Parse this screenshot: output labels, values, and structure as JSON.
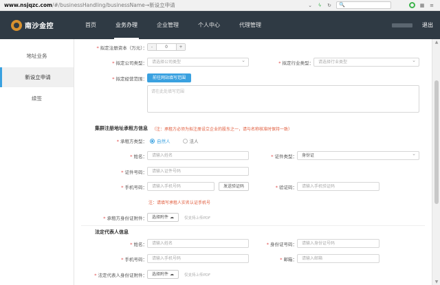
{
  "browser": {
    "url_host": "www.nsjqzc.com",
    "url_path": "/#/businessHandling/businessName→新设立申请",
    "search_placeholder": "🔍"
  },
  "topnav": {
    "logo_text": "南沙金控",
    "items": [
      "首页",
      "业务办理",
      "企业管理",
      "个人中心",
      "代理管理"
    ],
    "logout": "退出"
  },
  "sidebar": {
    "items": [
      "地址业务",
      "新设立申请",
      "续签"
    ]
  },
  "form": {
    "capital": {
      "label": "拟定注册资本（万元）：",
      "minus": "-",
      "value": "0",
      "plus": "+"
    },
    "company_type": {
      "label": "拟定公司类型：",
      "placeholder": "请选择公司类型"
    },
    "industry_type": {
      "label": "拟定行业类型：",
      "placeholder": "请选择行业类型"
    },
    "scope": {
      "label": "拟定经营范围：",
      "button": "前往网站填写范围",
      "placeholder": "请在此处填写范围"
    },
    "lessee_section": {
      "title": "集群注册地址承租方信息",
      "tip": "（注：承租方必须为拟注册设立企业的股东之一，请与名称核准时保持一致）",
      "type_label": "承租方类型：",
      "type_options": [
        "自然人",
        "法人"
      ],
      "name_label": "姓名：",
      "name_placeholder": "请输入姓名",
      "id_type_label": "证件类型：",
      "id_type_value": "身份证",
      "id_no_label": "证件号码：",
      "id_no_placeholder": "请输入证件号码",
      "phone_label": "手机号码：",
      "phone_placeholder": "请输入手机号码",
      "sms_button": "发送验证码",
      "code_label": "验证码：",
      "code_placeholder": "请输入手机验证码",
      "phone_tip": "注：请填写承租人实名认证手机号",
      "attach_label": "承租方身份证附件：",
      "upload_button": "选择附件",
      "upload_hint": "仅支持上传PDF"
    },
    "legal_section": {
      "title": "法定代表人信息",
      "name_label": "姓名：",
      "name_placeholder": "请输入姓名",
      "id_label": "身份证号码：",
      "id_placeholder": "请输入身份证号码",
      "phone_label": "手机号码：",
      "phone_placeholder": "请输入手机号码",
      "email_label": "邮箱：",
      "email_placeholder": "请输入邮箱",
      "attach_label": "法定代表人身份证附件：",
      "upload_button": "选择附件",
      "upload_hint": "仅支持上传PDF"
    }
  }
}
